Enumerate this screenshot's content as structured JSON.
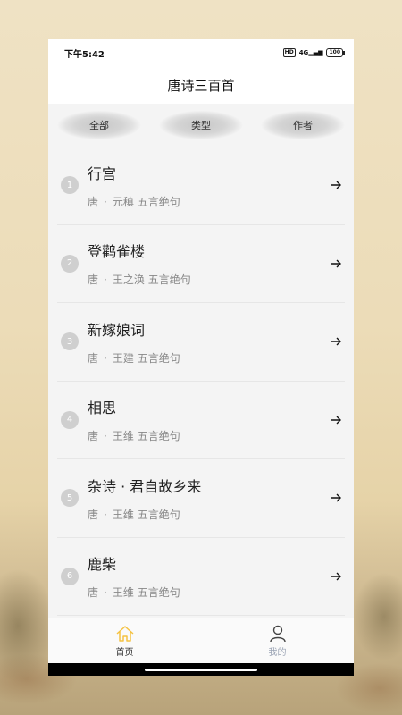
{
  "status": {
    "time": "下午5:42",
    "hd": "HD",
    "signal": "4G",
    "battery": "100"
  },
  "header": {
    "title": "唐诗三百首"
  },
  "tabs": [
    {
      "label": "全部"
    },
    {
      "label": "类型"
    },
    {
      "label": "作者"
    }
  ],
  "poems": [
    {
      "index": "1",
      "title": "行宫",
      "dynasty": "唐",
      "sep": "·",
      "author": "元稹",
      "form": "五言绝句"
    },
    {
      "index": "2",
      "title": "登鹳雀楼",
      "dynasty": "唐",
      "sep": "·",
      "author": "王之涣",
      "form": "五言绝句"
    },
    {
      "index": "3",
      "title": "新嫁娘词",
      "dynasty": "唐",
      "sep": "·",
      "author": "王建",
      "form": "五言绝句"
    },
    {
      "index": "4",
      "title": "相思",
      "dynasty": "唐",
      "sep": "·",
      "author": "王维",
      "form": "五言绝句"
    },
    {
      "index": "5",
      "title": "杂诗 · 君自故乡来",
      "dynasty": "唐",
      "sep": "·",
      "author": "王维",
      "form": "五言绝句"
    },
    {
      "index": "6",
      "title": "鹿柴",
      "dynasty": "唐",
      "sep": "·",
      "author": "王维",
      "form": "五言绝句"
    }
  ],
  "nav": {
    "home_label": "首页",
    "mine_label": "我的",
    "active_color": "#f5c242",
    "inactive_color": "#9aa3b4"
  }
}
